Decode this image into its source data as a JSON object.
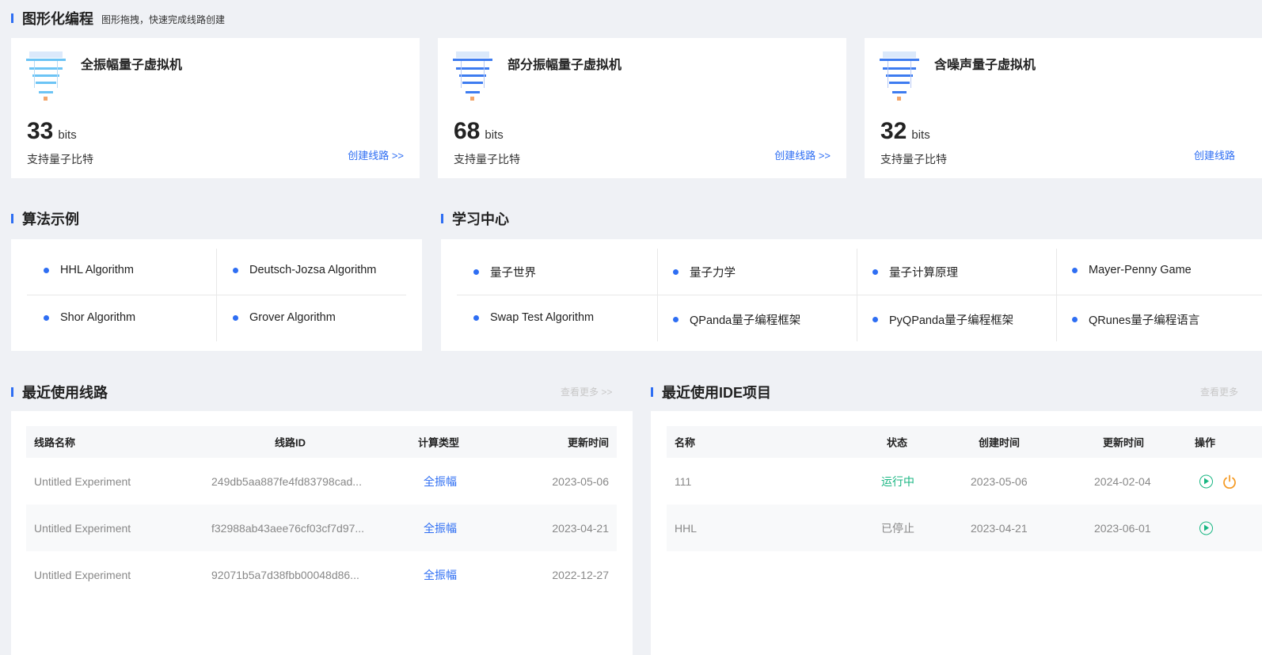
{
  "graphical": {
    "title": "图形化编程",
    "subtitle": "图形拖拽，快速完成线路创建",
    "cards": [
      {
        "name": "全振幅量子虚拟机",
        "bits": "33",
        "unit": "bits",
        "desc": "支持量子比特",
        "link": "创建线路 >>"
      },
      {
        "name": "部分振幅量子虚拟机",
        "bits": "68",
        "unit": "bits",
        "desc": "支持量子比特",
        "link": "创建线路 >>"
      },
      {
        "name": "含噪声量子虚拟机",
        "bits": "32",
        "unit": "bits",
        "desc": "支持量子比特",
        "link": "创建线路"
      }
    ]
  },
  "algorithms": {
    "title": "算法示例",
    "items": [
      "HHL Algorithm",
      "Deutsch-Jozsa Algorithm",
      "Shor Algorithm",
      "Grover Algorithm"
    ]
  },
  "learning": {
    "title": "学习中心",
    "items": [
      "量子世界",
      "量子力学",
      "量子计算原理",
      "Mayer-Penny Game",
      "Swap Test Algorithm",
      "QPanda量子编程框架",
      "PyQPanda量子编程框架",
      "QRunes量子编程语言"
    ]
  },
  "recent_circuits": {
    "title": "最近使用线路",
    "more": "查看更多 >>",
    "columns": [
      "线路名称",
      "线路ID",
      "计算类型",
      "更新时间"
    ],
    "rows": [
      [
        "Untitled Experiment",
        "249db5aa887fe4fd83798cad...",
        "全振幅",
        "2023-05-06"
      ],
      [
        "Untitled Experiment",
        "f32988ab43aee76cf03cf7d97...",
        "全振幅",
        "2023-04-21"
      ],
      [
        "Untitled Experiment",
        "92071b5a7d38fbb00048d86...",
        "全振幅",
        "2022-12-27"
      ]
    ]
  },
  "recent_ide": {
    "title": "最近使用IDE项目",
    "more": "查看更多",
    "columns": [
      "名称",
      "状态",
      "创建时间",
      "更新时间",
      "操作"
    ],
    "rows": [
      [
        "111",
        "运行中",
        "2023-05-06",
        "2024-02-04"
      ],
      [
        "HHL",
        "已停止",
        "2023-04-21",
        "2023-06-01"
      ]
    ]
  },
  "colors": {
    "accent": "#2e6ef3",
    "running": "#18b682",
    "power": "#f59a23"
  }
}
